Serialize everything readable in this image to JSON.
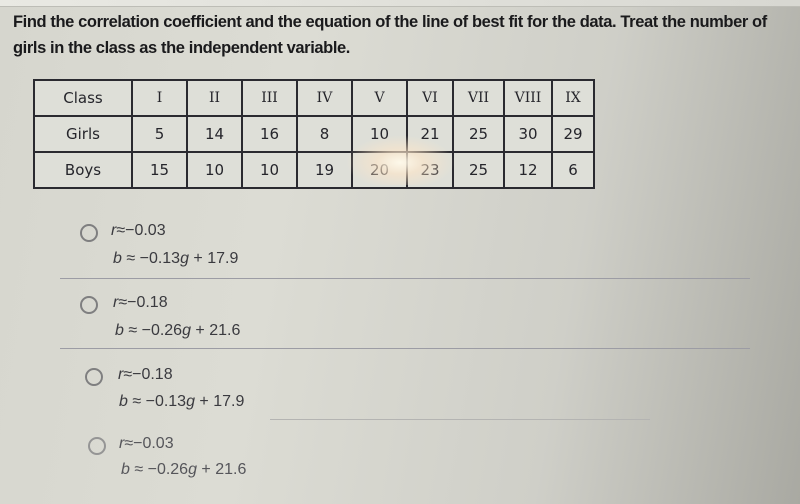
{
  "question": "Find the correlation coefficient and the equation of the line of best fit for the data. Treat the number of girls in the class as the independent variable.",
  "table": {
    "rows": [
      {
        "label": "Class",
        "values": [
          "I",
          "II",
          "III",
          "IV",
          "V",
          "VI",
          "VII",
          "VIII",
          "IX"
        ]
      },
      {
        "label": "Girls",
        "values": [
          "5",
          "14",
          "16",
          "8",
          "10",
          "21",
          "25",
          "30",
          "29"
        ]
      },
      {
        "label": "Boys",
        "values": [
          "15",
          "10",
          "10",
          "19",
          "20",
          "23",
          "25",
          "12",
          "6"
        ]
      }
    ]
  },
  "options": [
    {
      "r_var": "r",
      "r_rel": "≈",
      "r_val": "−0.03",
      "b_var": "b",
      "b_rel": "≈",
      "b_coef": "−0.13",
      "b_x": "g",
      "b_rest": " + 17.9",
      "selected": false
    },
    {
      "r_var": "r",
      "r_rel": "≈",
      "r_val": "−0.18",
      "b_var": "b",
      "b_rel": "≈",
      "b_coef": "−0.26",
      "b_x": "g",
      "b_rest": " + 21.6",
      "selected": false
    },
    {
      "r_var": "r",
      "r_rel": "≈",
      "r_val": "−0.18",
      "b_var": "b",
      "b_rel": "≈",
      "b_coef": "−0.13",
      "b_x": "g",
      "b_rest": " + 17.9",
      "selected": false
    },
    {
      "r_var": "r",
      "r_rel": "≈",
      "r_val": "−0.03",
      "b_var": "b",
      "b_rel": "≈",
      "b_coef": "−0.26",
      "b_x": "g",
      "b_rest": " + 21.6",
      "selected": false
    }
  ]
}
